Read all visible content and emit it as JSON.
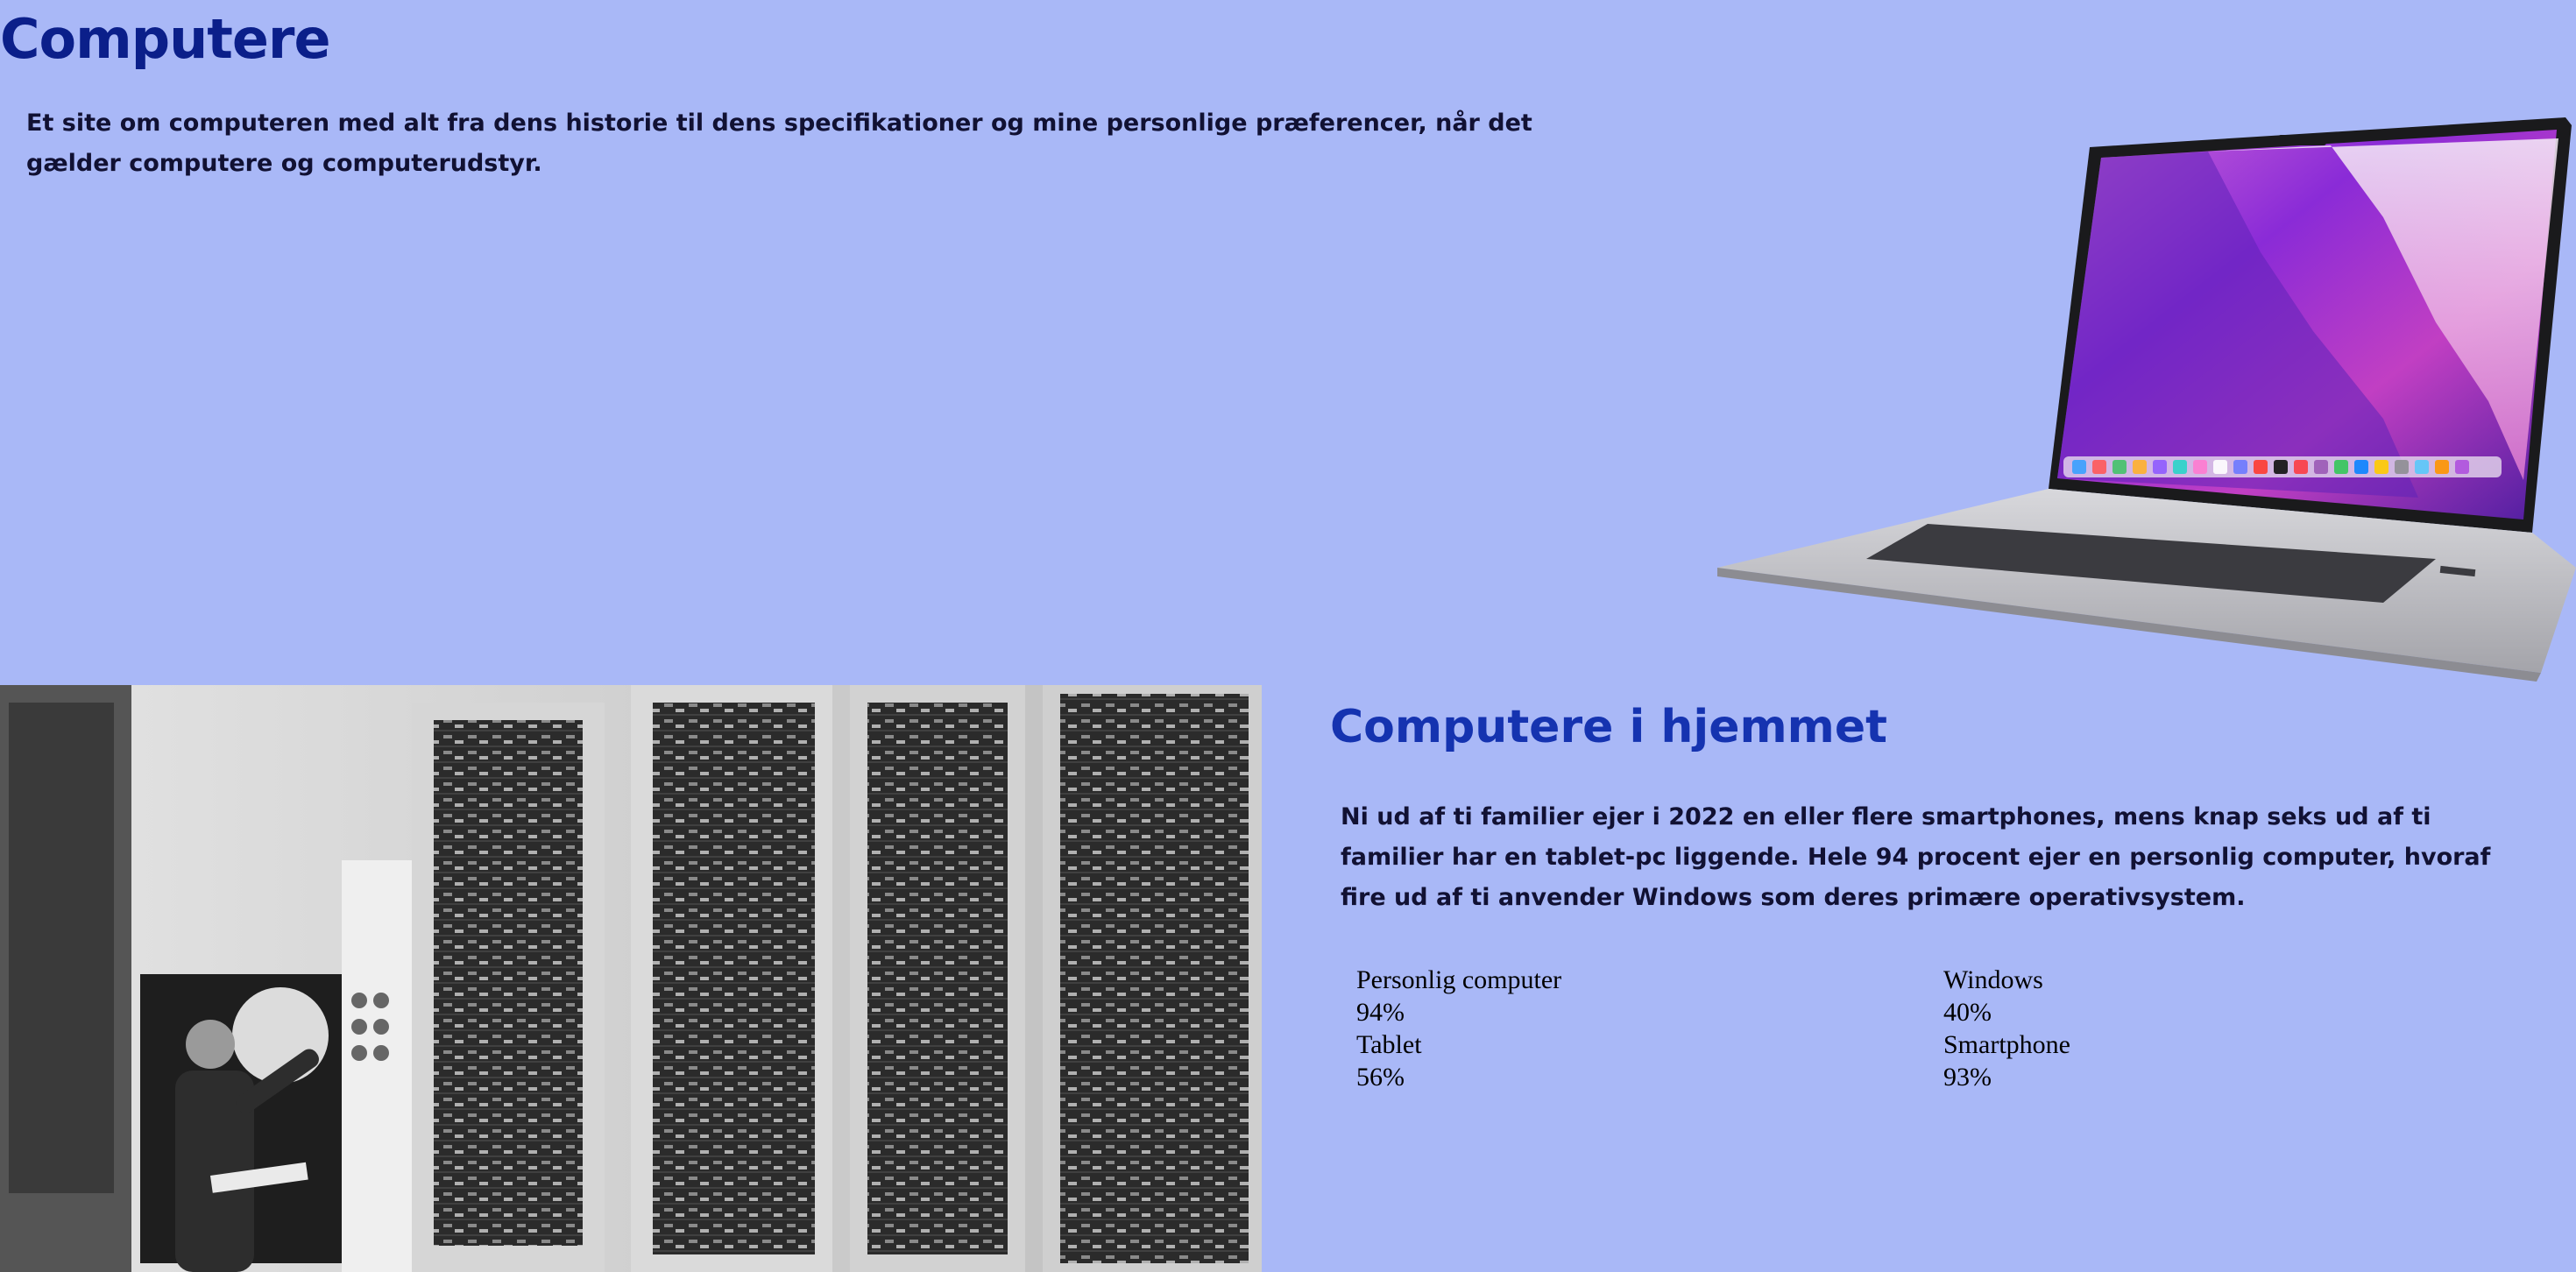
{
  "header": {
    "title": "Computere",
    "intro": "Et site om computeren med alt fra dens historie til dens specifikationer og mine personlige præferencer, når det gælder computere og computerudstyr."
  },
  "images": {
    "laptop": "laptop-image",
    "history": "mainframe-photo"
  },
  "home_section": {
    "title": "Computere i hjemmet",
    "text": "Ni ud af ti familier ejer i 2022 en eller flere smartphones, mens knap seks ud af ti familier har en tablet-pc liggende. Hele 94 procent ejer en personlig computer, hvoraf fire ud af ti anvender Windows som deres primære operativsystem."
  },
  "stats": [
    {
      "label": "Personlig computer",
      "value": "94%"
    },
    {
      "label": "Windows",
      "value": "40%"
    },
    {
      "label": "Tablet",
      "value": "56%"
    },
    {
      "label": "Smartphone",
      "value": "93%"
    }
  ],
  "colors": {
    "background": "#a9b8f7",
    "title": "#0b1f8a",
    "section_title": "#1533b0"
  }
}
